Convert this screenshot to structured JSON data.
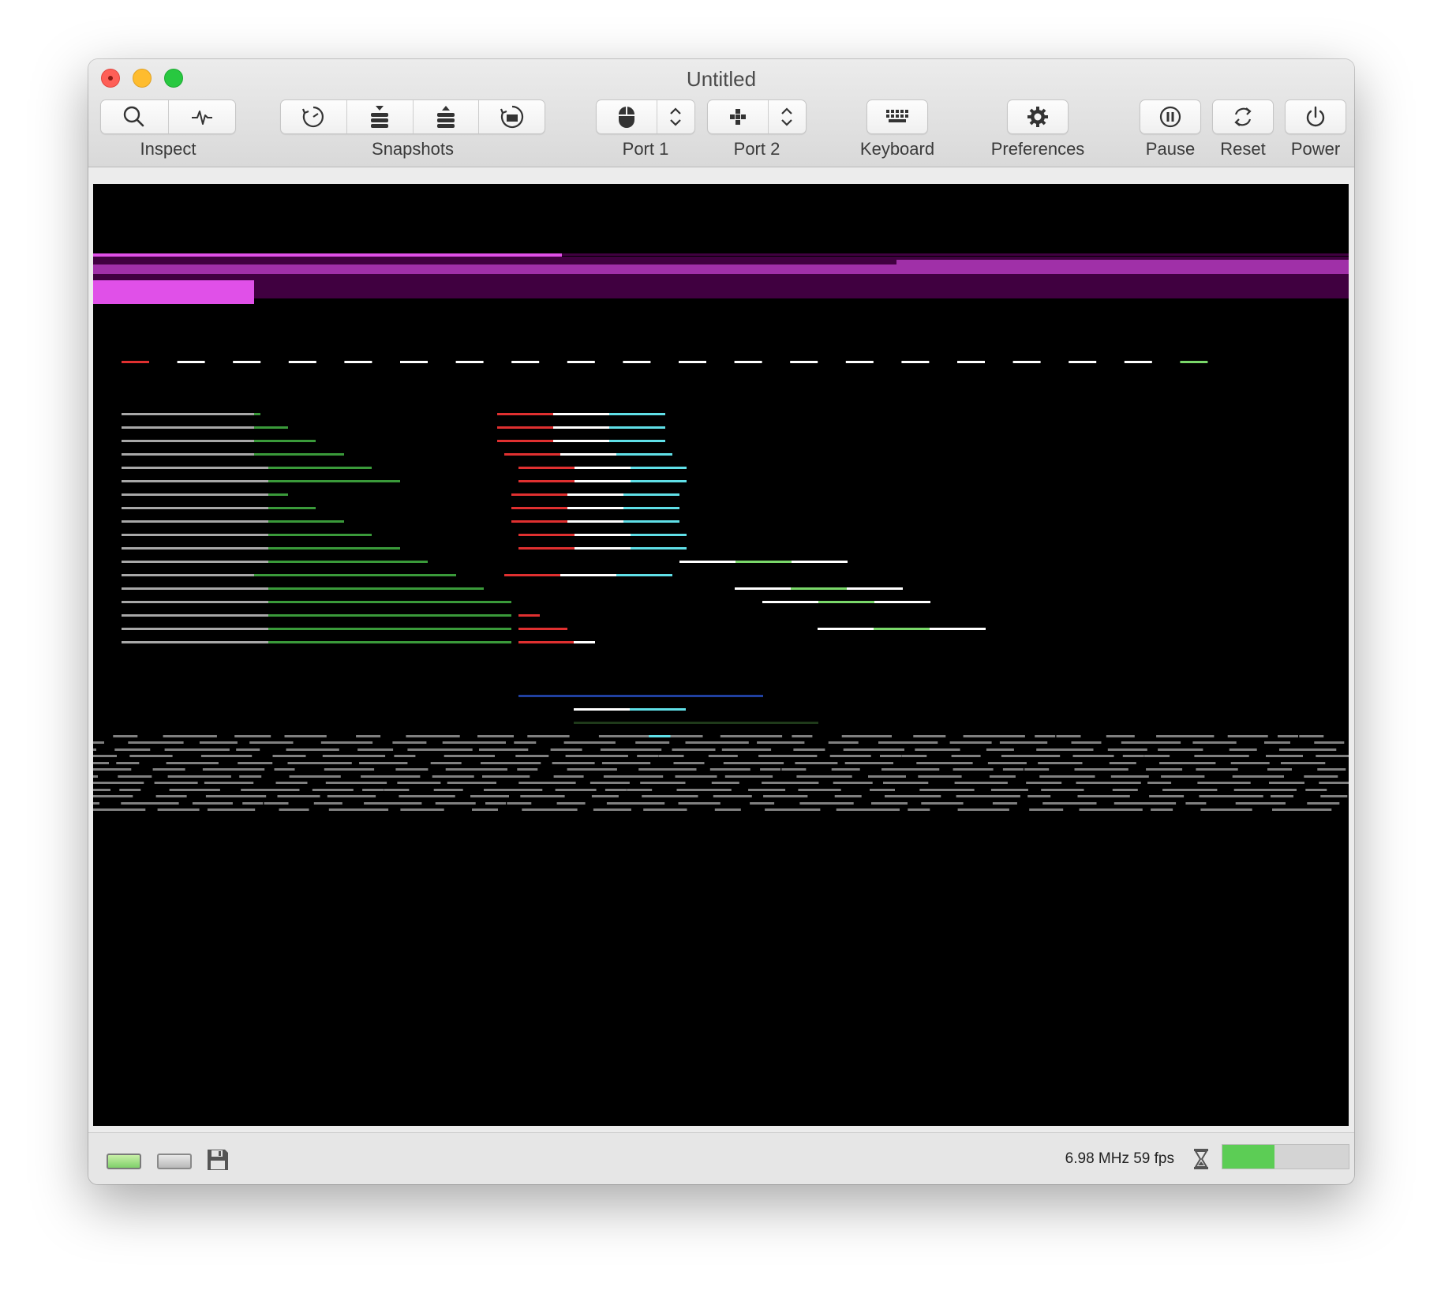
{
  "window": {
    "title": "Untitled"
  },
  "toolbar": {
    "inspect_label": "Inspect",
    "snapshots_label": "Snapshots",
    "port1_label": "Port 1",
    "port2_label": "Port 2",
    "keyboard_label": "Keyboard",
    "preferences_label": "Preferences",
    "pause_label": "Pause",
    "reset_label": "Reset",
    "power_label": "Power",
    "inspect_icons": [
      "magnifier-icon",
      "activity-icon"
    ],
    "snapshot_icons": [
      "snapshot-timer-icon",
      "take-snapshot-icon",
      "restore-snapshot-icon",
      "snapshot-browser-icon"
    ],
    "port1_icon": "mouse-icon",
    "port2_icon": "joystick-icon",
    "keyboard_icon": "keyboard-icon",
    "preferences_icon": "gear-icon",
    "pause_icon": "pause-icon",
    "reset_icon": "reset-icon",
    "power_icon": "power-icon"
  },
  "statusbar": {
    "speed_text": "6.98 MHz 59 fps",
    "drive1_state": "active",
    "drive2_state": "idle",
    "load_meter_fraction": 0.41,
    "colors": {
      "meter_fill": "#5ccd55",
      "meter_track": "#d4d4d4"
    }
  },
  "emulator_screen": {
    "background": "#000000",
    "palette": [
      "#e050e8",
      "#a030a8",
      "#400040",
      "#e03030",
      "#ffffff",
      "#60e0e8",
      "#7ad86a",
      "#3a9a3a",
      "#a8a8a8",
      "#2040a0",
      "#808080"
    ]
  }
}
